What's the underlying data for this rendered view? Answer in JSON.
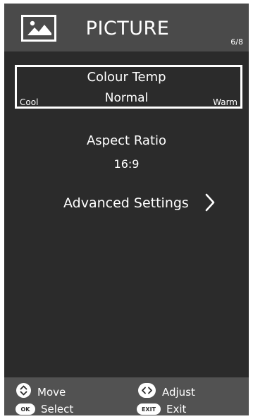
{
  "header": {
    "title": "PICTURE",
    "page_indicator": "6/8",
    "icon": "picture-icon"
  },
  "items": [
    {
      "title": "Colour Temp",
      "value": "Normal",
      "range_min": "Cool",
      "range_max": "Warm",
      "selected": true
    },
    {
      "title": "Aspect Ratio",
      "value": "16:9",
      "selected": false
    }
  ],
  "advanced": {
    "label": "Advanced Settings",
    "icon": "chevron-right-icon"
  },
  "footer": {
    "move": {
      "label": "Move",
      "icon": "up-down-icon"
    },
    "adjust": {
      "label": "Adjust",
      "icon": "left-right-icon"
    },
    "select": {
      "label": "Select",
      "badge": "OK"
    },
    "exit": {
      "label": "Exit",
      "badge": "EXIT"
    }
  },
  "colors": {
    "background": "#2b2b2b",
    "header": "#4a4a4a",
    "footer": "#525252",
    "text": "#ffffff"
  }
}
